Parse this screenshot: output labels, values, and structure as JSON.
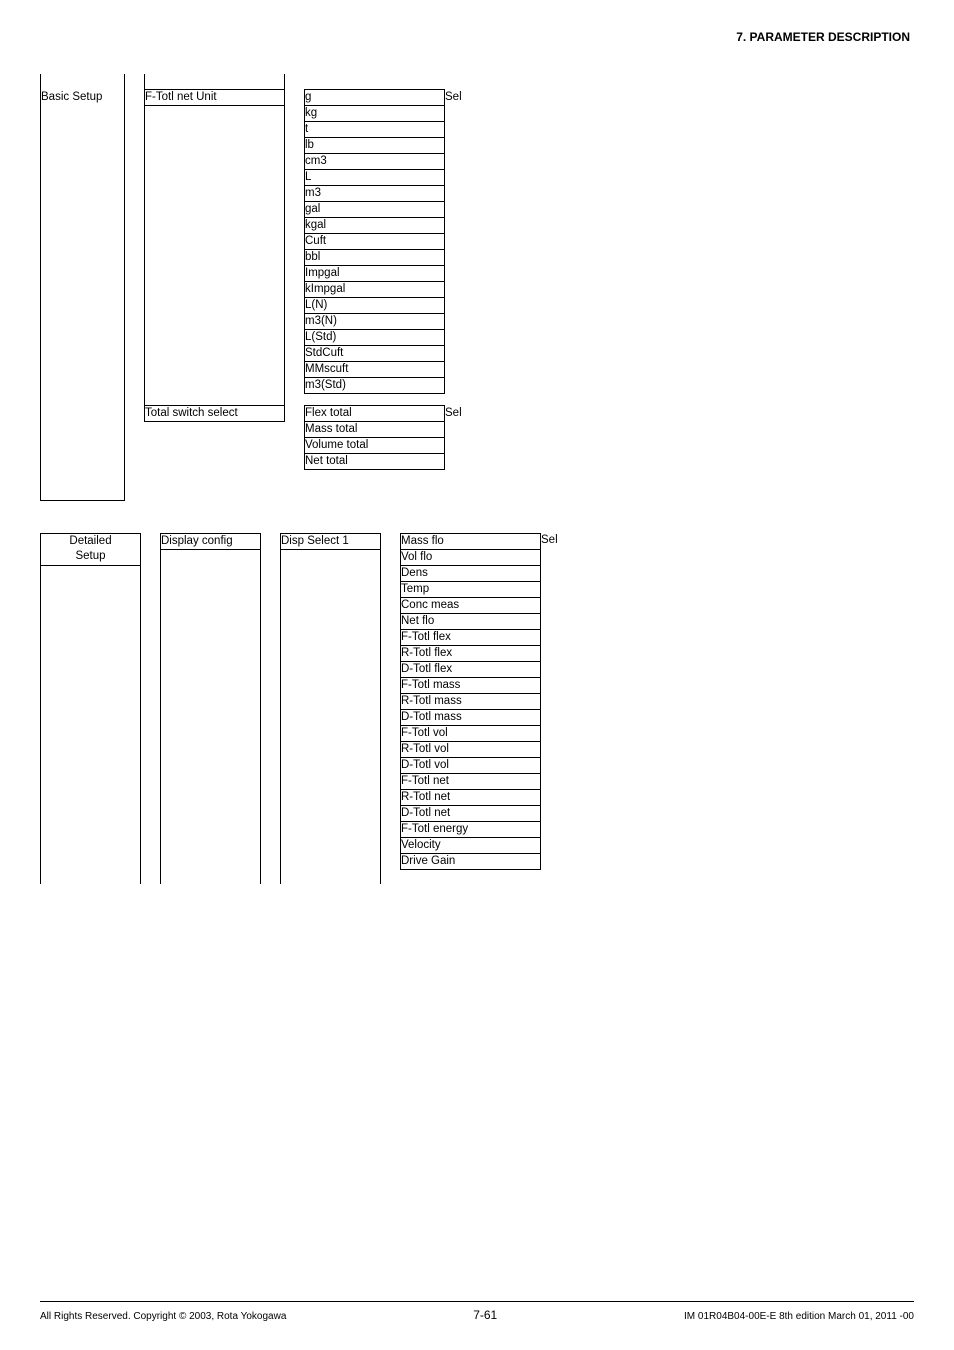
{
  "header": {
    "title": "7.  PARAMETER DESCRIPTION"
  },
  "tree1": {
    "menu": "Basic Setup",
    "param1": {
      "label": "F-Totl net Unit",
      "annot": "Sel",
      "options": [
        "g",
        "kg",
        "t",
        "lb",
        "cm3",
        "L",
        "m3",
        "gal",
        "kgal",
        "Cuft",
        "bbl",
        "Impgal",
        "kImpgal",
        "L(N)",
        "m3(N)",
        "L(Std)",
        "StdCuft",
        "MMscuft",
        "m3(Std)"
      ]
    },
    "param2": {
      "label": "Total switch select",
      "annot": "Sel",
      "options": [
        "Flex total",
        "Mass total",
        "Volume total",
        "Net total"
      ]
    }
  },
  "tree2": {
    "menu": "Detailed\nSetup",
    "sub": "Display config",
    "param": {
      "label": "Disp Select 1",
      "annot": "Sel",
      "options": [
        "Mass flo",
        "Vol flo",
        "Dens",
        "Temp",
        "Conc meas",
        "Net flo",
        "F-Totl flex",
        "R-Totl flex",
        "D-Totl flex",
        "F-Totl mass",
        "R-Totl mass",
        "D-Totl mass",
        "F-Totl vol",
        "R-Totl vol",
        "D-Totl vol",
        "F-Totl net",
        "R-Totl net",
        "D-Totl net",
        "F-Totl energy",
        "Velocity",
        "Drive Gain"
      ]
    }
  },
  "footer": {
    "left": "All Rights Reserved. Copyright © 2003, Rota Yokogawa",
    "center": "7-61",
    "right": "IM 01R04B04-00E-E  8th edition March 01, 2011 -00"
  }
}
